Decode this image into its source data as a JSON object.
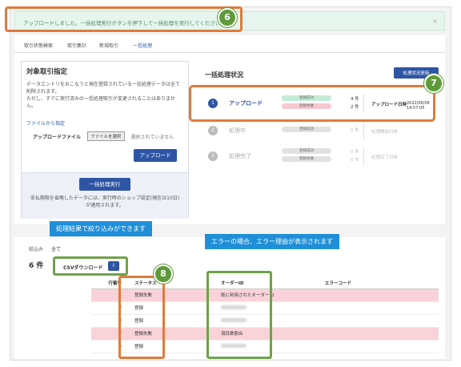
{
  "alert": {
    "message": "アップロードしました。一括処理実行ボタンを押下して一括処理を実行してください。",
    "close": "×"
  },
  "tabs": [
    "取引状態検索",
    "取引集計",
    "新規取引",
    "一括処理"
  ],
  "left": {
    "title": "対象取引指定",
    "desc": "データエントリをおこなうと現在登録されている一括処理データは全て削除されます。\nただし、すでに実行済みの一括処理取引が変更されることはありません。",
    "file_link": "ファイルから指定",
    "file_label": "アップロードファイル",
    "file_button": "ファイルを選択",
    "file_none": "選択されていません",
    "upload_button": "アップロード",
    "exec_button": "一括処理実行",
    "note": "支払期限を省略したデータには、実行時のショップ設定(現在は10日)が適用されます。"
  },
  "status": {
    "title": "一括処理状況",
    "button": "処理状況更新",
    "steps": [
      {
        "num": "1",
        "label": "アップロード",
        "pills": [
          "登録成功",
          "登録失敗"
        ],
        "counts": [
          "4 件",
          "2 件"
        ],
        "date_label": "アップロード日時",
        "date": "2022/06/06 14:57:05"
      },
      {
        "num": "2",
        "label": "処理中",
        "pills": [
          "登録成功"
        ],
        "counts": [
          "0 件"
        ],
        "date_label": "処理開始日時",
        "date": ""
      },
      {
        "num": "3",
        "label": "処理完了",
        "pills": [
          "登録成功",
          "登録失敗"
        ],
        "counts": [
          "0 件",
          "0 件"
        ],
        "date_label": "処理完了日時",
        "date": ""
      }
    ]
  },
  "callouts": {
    "badge6": "6",
    "badge7": "7",
    "badge8": "8",
    "tip_filter": "処理結果で絞り込みができます",
    "tip_error": "エラーの場合、エラー理由が表示されます"
  },
  "list": {
    "filter_label": "絞込み",
    "filter_value": "全て",
    "count": "6 件",
    "csv_label": "CSVダウンロード",
    "headers": [
      "行番号",
      "ステータス",
      "オーダーID",
      "エラーコード"
    ],
    "rows": [
      {
        "num": "1",
        "status": "登録失敗",
        "order": "既に利用されたオーダーID",
        "error": true
      },
      {
        "num": "2",
        "status": "登録",
        "order": "",
        "error": false
      },
      {
        "num": "3",
        "status": "登録",
        "order": "",
        "error": false
      },
      {
        "num": "4",
        "status": "登録失敗",
        "order": "項目数割合",
        "error": true
      },
      {
        "num": "5",
        "status": "登録",
        "order": "",
        "error": false
      }
    ]
  }
}
